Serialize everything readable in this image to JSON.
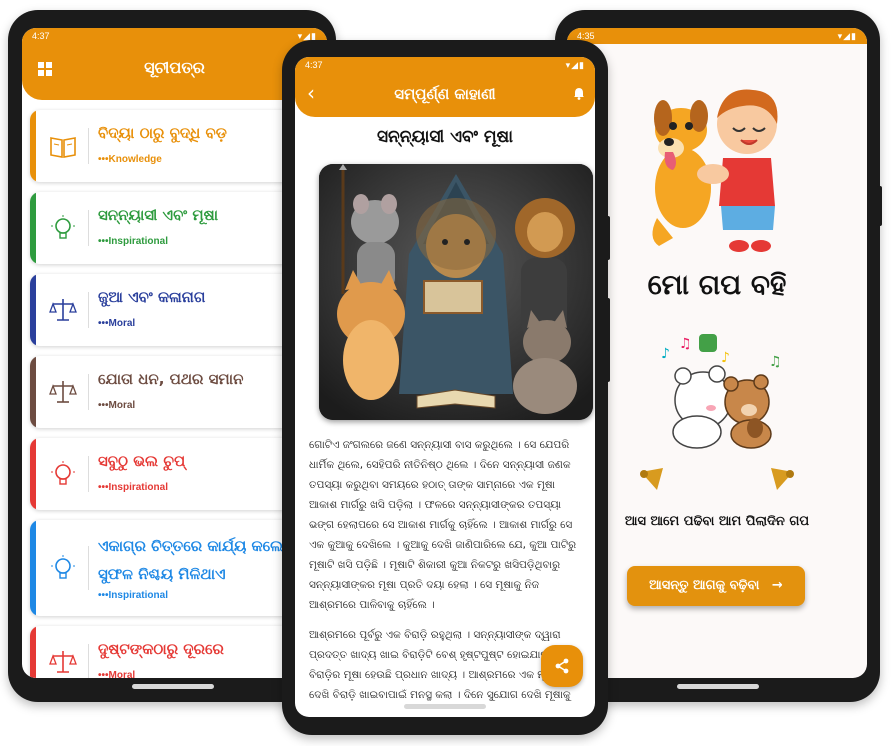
{
  "colors": {
    "primary": "#e8900a",
    "knowledge": "#e8900a",
    "inspirational_green": "#2e9b3e",
    "moral_blue": "#2a3f9c",
    "moral_brown": "#6d4c41",
    "inspirational_red": "#e53935",
    "inspirational_cyan": "#1e88e5",
    "moral_red": "#e53935"
  },
  "list_screen": {
    "status_time": "4:37",
    "title": "ସୂଚୀପତ୍ର",
    "menu_icon": "grid-icon",
    "items": [
      {
        "title": "ବିଦ୍ୟା ଠାରୁ ବୁଦ୍ଧି ବଡ଼",
        "category": "Knowledge",
        "icon": "book-icon"
      },
      {
        "title": "ସନ୍ନ୍ୟାସୀ ଏବଂ ମୂଷା",
        "category": "Inspirational",
        "icon": "lightbulb-icon"
      },
      {
        "title": "ଜୁଆ ଏବଂ କଳାନାଗ",
        "category": "Moral",
        "icon": "scales-icon"
      },
      {
        "title": "ଯୋତା ଧନ, ପଥର ସମାନ",
        "category": "Moral",
        "icon": "scales-icon"
      },
      {
        "title": "ସବୁଠୁ ଭଲ ଚୁପ୍",
        "category": "Inspirational",
        "icon": "lightbulb-icon"
      },
      {
        "title": "ଏକାଗ୍ର ଚିତ୍ତରେ କାର୍ଯ୍ୟ କଲେ, ସୁଫଳ ନିଶ୍ଚୟ ମିଳିଥାଏ",
        "category": "Inspirational",
        "icon": "lightbulb-icon"
      },
      {
        "title": "ଦୁଷ୍ଟଙ୍କଠାରୁ ଦୂରରେ",
        "category": "Moral",
        "icon": "scales-icon"
      }
    ]
  },
  "story_screen": {
    "status_time": "4:37",
    "title": "ସମ୍ପୂର୍ଣ୍ଣ କାହାଣୀ",
    "story_title": "ସନ୍ନ୍ୟାସୀ ଏବଂ ମୂଷା",
    "paragraph1": "ଗୋଟିଏ ଜଂଗଲରେ ଜଣେ ସନ୍ନ୍ୟାସୀ ବାସ କରୁଥିଲେ । ସେ ଯେପରି ଧାର୍ମିକ ଥିଲେ, ସେହିପରି ନୀତିନିଷ୍ଠ ଥିଲେ । ଦିନେ ସନ୍ନ୍ୟାସୀ ଜଣକ ତପସ୍ୟା କରୁଥିବା ସମୟରେ ହଠାତ୍ ତାଙ୍କ ସାମ୍ନାରେ ଏକ ମୂଷା ଆକାଶ ମାର୍ଗରୁ ଖସି ପଡ଼ିଲା । ଫଳରେ ସନ୍ନ୍ୟାସୀଙ୍କର ତପସ୍ୟା ଭଙ୍ଗ ହେଲାପରେ ସେ ଆକାଶ ମାର୍ଗକୁ ଚାହିଁଲେ । ଆକାଶ ମାର୍ଗରୁ ସେ ଏକ କୁଆକୁ ଦେଖିଲେ । କୁଆକୁ ଦେଖି ଜାଣିପାରିଲେ ଯେ, କୁଆ ପାଟିରୁ ମୂଷାଟି ଖସି ପଡ଼ିଛି । ମୂଷାଟି ଶିକାରୀ କୁଆ ନିକଟରୁ ଖସିପଡ଼ିଥିବାରୁ ସନ୍ନ୍ୟାସୀଙ୍କର ମୂଷା ପ୍ରତି ଦୟା ହେଲା । ସେ ମୂଷାକୁ ନିଜ ଆଶ୍ରମରେ ପାଳିବାକୁ ଚାହିଁଲେ ।",
    "paragraph2": "ଆଶ୍ରମରେ ପୂର୍ବରୁ ଏକ ବିରାଡ଼ି ରହୁଥିଲା । ସନ୍ନ୍ୟାସୀଙ୍କ ଦ୍ୱାରା ପ୍ରଦତ୍ତ ଖାଦ୍ୟ ଖାଇ ବିରାଡ଼ିଟି ବେଶ୍ ହୃଷ୍ଟପୁଷ୍ଟ ହୋଇଯାଇଥିଲା । ବିରାଡ଼ିର ମୂଷା ହେଉଛି ପ୍ରଧାନ ଖାଦ୍ୟ । ଆଶ୍ରମରେ ଏକ ମୂଷାକୁ ଦେଖି ବିରାଡ଼ି ଖାଇବାପାଇଁ ମନସ୍ଥ କଲା । ଦିନେ ସୁଯୋଗ ଦେଖି ମୂଷାକୁ",
    "share_icon": "share-icon"
  },
  "welcome_screen": {
    "status_time": "4:35",
    "app_title": "ମୋ ଗପ ବହି",
    "subtitle": "ଆସ ଆମେ ପଢିବା ଆମ ପିଲାଦିନ ଗପ",
    "button_label": "ଆସନ୍ତୁ ଆଗକୁ ବଢ଼ିବା",
    "button_icon": "arrow-right-icon"
  }
}
